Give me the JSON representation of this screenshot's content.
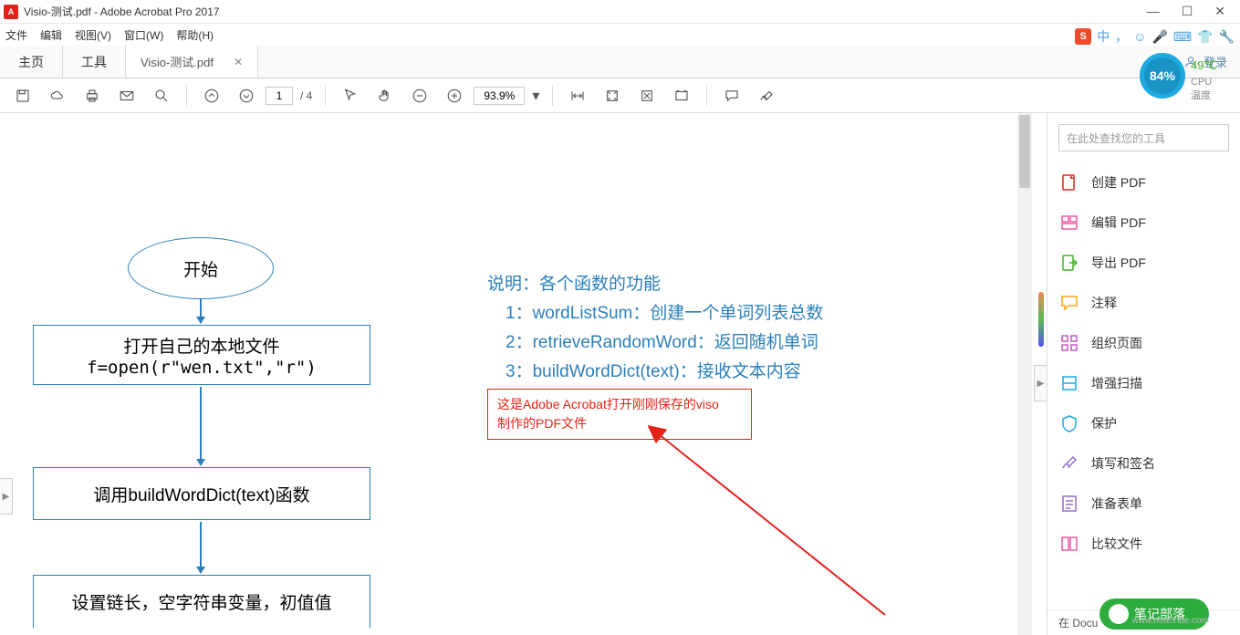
{
  "title": "Visio-测试.pdf - Adobe Acrobat Pro 2017",
  "menus": {
    "file": "文件",
    "edit": "编辑",
    "view": "视图(V)",
    "window": "窗口(W)",
    "help": "帮助(H)"
  },
  "tray": {
    "ime": "中",
    "dot": "，"
  },
  "tabs": {
    "home": "主页",
    "tools": "工具",
    "doc": "Visio-测试.pdf",
    "login": "登录"
  },
  "widget": {
    "pct": "84%",
    "temp": "49℃",
    "cpu": "CPU温度"
  },
  "toolbar": {
    "page_current": "1",
    "page_total": "/ 4",
    "zoom": "93.9%"
  },
  "sidebar": {
    "search_placeholder": "在此处查找您的工具",
    "items": [
      {
        "label": "创建 PDF",
        "color": "#e2231a"
      },
      {
        "label": "编辑 PDF",
        "color": "#e85ca4"
      },
      {
        "label": "导出 PDF",
        "color": "#43b02a"
      },
      {
        "label": "注释",
        "color": "#f0a81e"
      },
      {
        "label": "组织页面",
        "color": "#c558c5"
      },
      {
        "label": "增强扫描",
        "color": "#1daae0"
      },
      {
        "label": "保护",
        "color": "#1daae0"
      },
      {
        "label": "填写和签名",
        "color": "#8b6fc9"
      },
      {
        "label": "准备表单",
        "color": "#8b6fc9"
      },
      {
        "label": "比较文件",
        "color": "#e85ca4"
      }
    ],
    "store": "在 Docu"
  },
  "flow": {
    "start": "开始",
    "open1": "打开自己的本地文件",
    "open2": "f=open(r\"wen.txt\",\"r\")",
    "call": "调用buildWordDict(text)函数",
    "set": "设置链长，空字符串变量，初值值"
  },
  "explain": {
    "title": "说明：各个函数的功能",
    "l1": "1：wordListSum：创建一个单词列表总数",
    "l2": "2：retrieveRandomWord：返回随机单词",
    "l3": "3：buildWordDict(text)：接收文本内容"
  },
  "annotation": {
    "l1": "这是Adobe Acrobat打开刚刚保存的viso",
    "l2": "制作的PDF文件"
  },
  "watermark": "笔记部落"
}
